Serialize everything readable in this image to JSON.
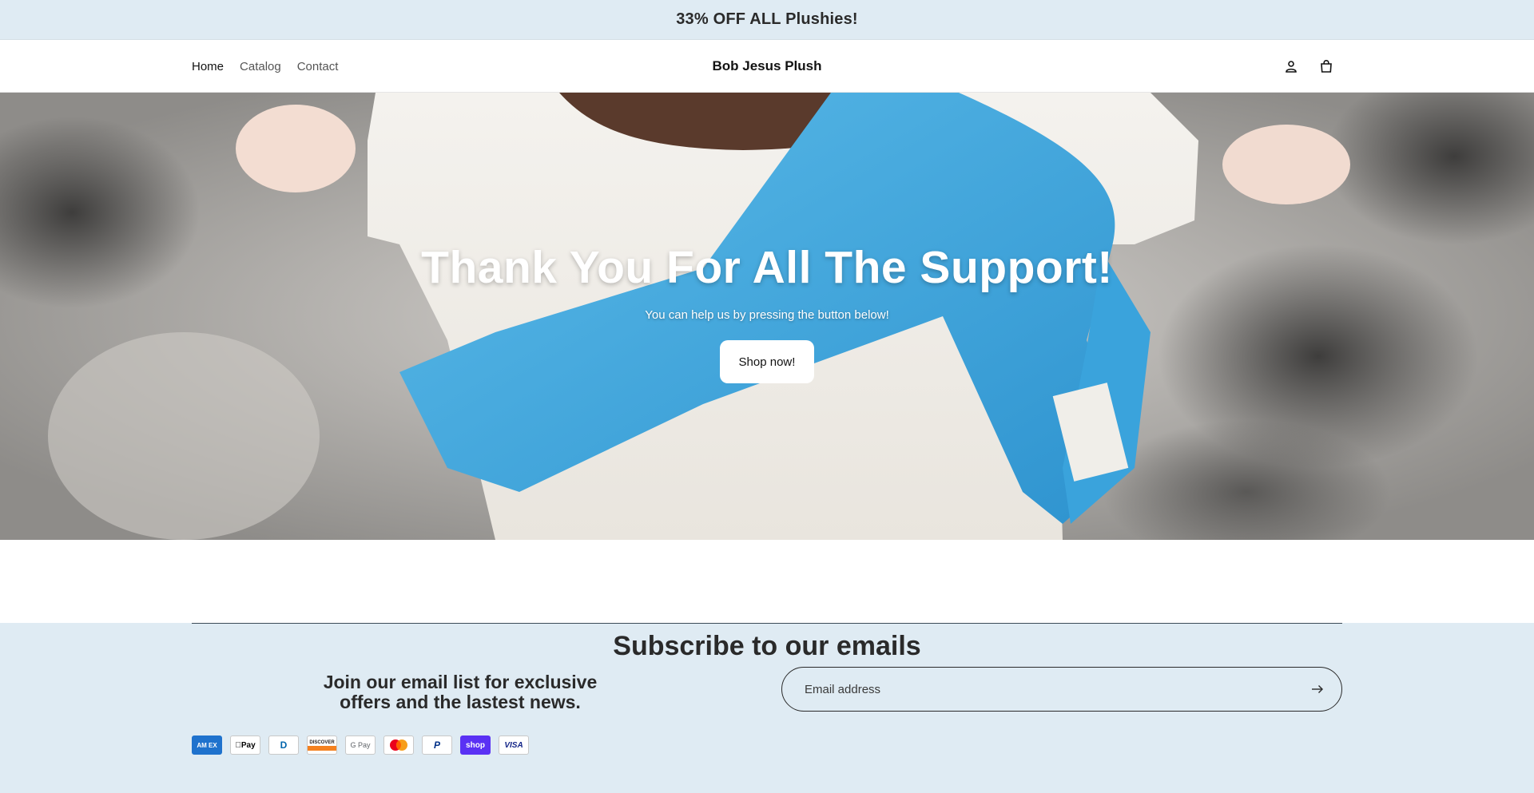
{
  "announcement": {
    "text": "33% OFF ALL Plushies!"
  },
  "header": {
    "nav": [
      {
        "label": "Home",
        "active": true
      },
      {
        "label": "Catalog",
        "active": false
      },
      {
        "label": "Contact",
        "active": false
      }
    ],
    "brand": "Bob Jesus Plush",
    "icons": [
      "account-icon",
      "cart-icon"
    ]
  },
  "hero": {
    "title": "Thank You For All The Support!",
    "subtitle": "You can help us by pressing the button below!",
    "button_label": "Shop now!"
  },
  "newsletter": {
    "title": "Subscribe to our emails",
    "text": "Join our email list for exclusive offers and the lastest news.",
    "email_placeholder": "Email address",
    "submit_icon": "arrow-right-icon"
  },
  "payments": [
    {
      "name": "amex",
      "label": "AM EX",
      "bg": "#1f72cd",
      "fg": "#ffffff"
    },
    {
      "name": "apple-pay",
      "label": "Pay",
      "bg": "#ffffff",
      "fg": "#000000"
    },
    {
      "name": "diners",
      "label": "D",
      "bg": "#ffffff",
      "fg": "#0165ac"
    },
    {
      "name": "discover",
      "label": "DISCOVER",
      "bg": "#ffffff",
      "fg": "#231f20"
    },
    {
      "name": "google-pay",
      "label": "G Pay",
      "bg": "#ffffff",
      "fg": "#5f6368"
    },
    {
      "name": "mastercard",
      "label": "",
      "bg": "#ffffff",
      "fg": "#000000"
    },
    {
      "name": "paypal",
      "label": "P",
      "bg": "#ffffff",
      "fg": "#003087"
    },
    {
      "name": "shop-pay",
      "label": "shop",
      "bg": "#5a31f4",
      "fg": "#ffffff"
    },
    {
      "name": "visa",
      "label": "VISA",
      "bg": "#ffffff",
      "fg": "#142688"
    }
  ],
  "colors": {
    "announcement_bg": "#dfebf3",
    "newsletter_bg": "#dfebf3",
    "hero_accent": "#3aa3dc"
  }
}
